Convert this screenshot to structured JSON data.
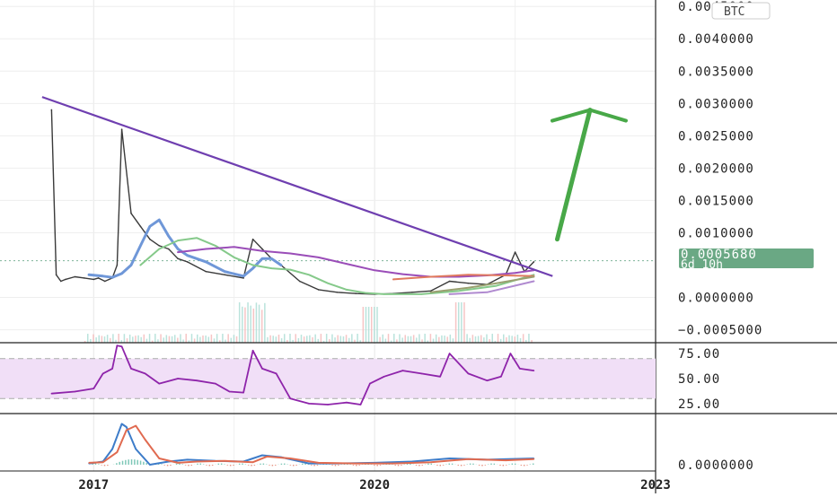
{
  "chart_data": [
    {
      "type": "line",
      "panel": "price",
      "currency_badge": "BTC",
      "ylim": [
        -0.0007,
        0.0046
      ],
      "y_ticks": [
        {
          "v": 0.0045,
          "label": "0.0045000"
        },
        {
          "v": 0.004,
          "label": "0.0040000"
        },
        {
          "v": 0.0035,
          "label": "0.0035000"
        },
        {
          "v": 0.003,
          "label": "0.0030000"
        },
        {
          "v": 0.0025,
          "label": "0.0025000"
        },
        {
          "v": 0.002,
          "label": "0.0020000"
        },
        {
          "v": 0.0015,
          "label": "0.0015000"
        },
        {
          "v": 0.001,
          "label": "0.0010000"
        },
        {
          "v": 0.0,
          "label": "0.0000000"
        },
        {
          "v": -0.0005,
          "label": "−0.0005000"
        }
      ],
      "last_price": {
        "value": 0.000568,
        "label": "0.0005680",
        "countdown": "6d 10h"
      },
      "series": [
        {
          "role": "price",
          "color": "#3a3a3a",
          "x": [
            2016.55,
            2016.6,
            2016.65,
            2016.7,
            2016.8,
            2016.9,
            2017.0,
            2017.05,
            2017.12,
            2017.2,
            2017.25,
            2017.3,
            2017.4,
            2017.5,
            2017.6,
            2017.7,
            2017.8,
            2017.9,
            2018.0,
            2018.2,
            2018.4,
            2018.6,
            2018.7,
            2018.8,
            2018.9,
            2019.0,
            2019.2,
            2019.4,
            2019.6,
            2019.8,
            2020.0,
            2020.2,
            2020.4,
            2020.6,
            2020.8,
            2021.0,
            2021.2,
            2021.4,
            2021.5,
            2021.6,
            2021.7
          ],
          "y": [
            0.0029,
            0.00035,
            0.00025,
            0.00028,
            0.00032,
            0.0003,
            0.00028,
            0.0003,
            0.00025,
            0.0003,
            0.0005,
            0.0026,
            0.0013,
            0.0011,
            0.0009,
            0.0008,
            0.00075,
            0.0006,
            0.00055,
            0.0004,
            0.00035,
            0.0003,
            0.0009,
            0.00075,
            0.0006,
            0.0005,
            0.00025,
            0.00012,
            8e-05,
            6e-05,
            5e-05,
            6e-05,
            8e-05,
            0.0001,
            0.00025,
            0.00022,
            0.0002,
            0.00035,
            0.0007,
            0.0004,
            0.00055
          ]
        },
        {
          "role": "ma-blue",
          "color": "#6f97d8",
          "x": [
            2016.95,
            2017.1,
            2017.2,
            2017.3,
            2017.4,
            2017.5,
            2017.6,
            2017.7,
            2017.8,
            2017.9,
            2018.0,
            2018.2,
            2018.4,
            2018.6,
            2018.7,
            2018.8,
            2018.9,
            2019.0
          ],
          "y": [
            0.00035,
            0.00033,
            0.00031,
            0.00037,
            0.0005,
            0.0008,
            0.0011,
            0.0012,
            0.00095,
            0.00075,
            0.00065,
            0.00055,
            0.0004,
            0.00033,
            0.00045,
            0.0006,
            0.0006,
            0.0005
          ]
        },
        {
          "role": "ma-green",
          "color": "#85c98a",
          "x": [
            2017.5,
            2017.7,
            2017.9,
            2018.1,
            2018.3,
            2018.5,
            2018.7,
            2018.9,
            2019.1,
            2019.3,
            2019.5,
            2019.7,
            2019.9,
            2020.1,
            2020.5,
            2020.9,
            2021.3,
            2021.7
          ],
          "y": [
            0.0005,
            0.00075,
            0.00088,
            0.00092,
            0.0008,
            0.00062,
            0.0005,
            0.00045,
            0.00043,
            0.00035,
            0.00022,
            0.00012,
            7e-05,
            5e-05,
            5e-05,
            0.0001,
            0.00018,
            0.00035
          ]
        },
        {
          "role": "ma-purple",
          "color": "#9a4db8",
          "x": [
            2017.9,
            2018.2,
            2018.5,
            2018.8,
            2019.1,
            2019.4,
            2019.7,
            2020.0,
            2020.3,
            2020.6,
            2020.9,
            2021.2,
            2021.5,
            2021.7
          ],
          "y": [
            0.0007,
            0.00075,
            0.00078,
            0.00072,
            0.00068,
            0.00062,
            0.00052,
            0.00042,
            0.00036,
            0.00032,
            0.00032,
            0.00034,
            0.00038,
            0.00042
          ]
        },
        {
          "role": "ma-red",
          "color": "#e07a5f",
          "x": [
            2020.2,
            2020.6,
            2021.0,
            2021.4,
            2021.7
          ],
          "y": [
            0.00028,
            0.00032,
            0.00035,
            0.00034,
            0.00033
          ]
        },
        {
          "role": "ma-olive",
          "color": "#9aa070",
          "x": [
            2020.6,
            2021.0,
            2021.3,
            2021.7
          ],
          "y": [
            8e-05,
            0.00015,
            0.00022,
            0.00032
          ]
        },
        {
          "role": "ma-lavender",
          "color": "#b08ad0",
          "x": [
            2020.8,
            2021.2,
            2021.7
          ],
          "y": [
            5e-05,
            8e-05,
            0.00025
          ]
        }
      ],
      "annotations": {
        "trendline": {
          "color": "#6f3fb0",
          "x": [
            2016.45,
            2021.9
          ],
          "y": [
            0.0031,
            0.00033
          ]
        },
        "arrow": {
          "color": "#48a848",
          "from": [
            2021.95,
            0.0009
          ],
          "to": [
            2022.3,
            0.0029
          ]
        }
      }
    },
    {
      "type": "line",
      "panel": "rsi",
      "ylim": [
        15,
        85
      ],
      "y_ticks": [
        {
          "v": 75,
          "label": "75.00"
        },
        {
          "v": 50,
          "label": "50.00"
        },
        {
          "v": 25,
          "label": "25.00"
        }
      ],
      "band": [
        30,
        70
      ],
      "series": [
        {
          "role": "rsi",
          "color": "#8e24aa",
          "x": [
            2016.55,
            2016.8,
            2017.0,
            2017.1,
            2017.2,
            2017.25,
            2017.3,
            2017.4,
            2017.55,
            2017.7,
            2017.9,
            2018.1,
            2018.3,
            2018.45,
            2018.6,
            2018.7,
            2018.8,
            2018.95,
            2019.1,
            2019.3,
            2019.5,
            2019.7,
            2019.85,
            2019.95,
            2020.1,
            2020.3,
            2020.5,
            2020.7,
            2020.8,
            2021.0,
            2021.2,
            2021.35,
            2021.45,
            2021.55,
            2021.7
          ],
          "y": [
            35,
            37,
            40,
            55,
            60,
            83,
            82,
            60,
            55,
            45,
            50,
            48,
            45,
            37,
            36,
            78,
            60,
            55,
            30,
            25,
            24,
            26,
            24,
            45,
            52,
            58,
            55,
            52,
            75,
            55,
            48,
            52,
            75,
            60,
            58
          ]
        }
      ]
    },
    {
      "type": "line",
      "panel": "macd",
      "ylim": [
        -1,
        8
      ],
      "y_ticks": [
        {
          "v": 0,
          "label": "0.0000000"
        }
      ],
      "series": [
        {
          "role": "macd",
          "color": "#3d7cc9",
          "x": [
            2016.95,
            2017.1,
            2017.2,
            2017.3,
            2017.35,
            2017.45,
            2017.6,
            2017.8,
            2018.0,
            2018.3,
            2018.6,
            2018.8,
            2019.0,
            2019.3,
            2019.6,
            2020.0,
            2020.4,
            2020.8,
            2021.2,
            2021.7
          ],
          "y": [
            0.2,
            0.5,
            2.5,
            6.5,
            6.0,
            2.5,
            0.0,
            0.5,
            0.8,
            0.6,
            0.5,
            1.5,
            1.2,
            0.2,
            0.2,
            0.3,
            0.5,
            1.0,
            0.8,
            1.0
          ]
        },
        {
          "role": "signal",
          "color": "#e06a50",
          "x": [
            2016.95,
            2017.1,
            2017.25,
            2017.35,
            2017.45,
            2017.55,
            2017.7,
            2017.9,
            2018.1,
            2018.4,
            2018.7,
            2018.85,
            2019.1,
            2019.4,
            2019.8,
            2020.2,
            2020.6,
            2021.0,
            2021.4,
            2021.7
          ],
          "y": [
            0.3,
            0.4,
            2.0,
            5.5,
            6.2,
            4.0,
            1.0,
            0.3,
            0.5,
            0.6,
            0.4,
            1.3,
            1.0,
            0.3,
            0.2,
            0.2,
            0.4,
            0.9,
            0.7,
            0.9
          ]
        }
      ]
    }
  ],
  "x_axis": {
    "xlim": [
      2016.0,
      2023.0
    ],
    "ticks": [
      {
        "v": 2017,
        "label": "2017"
      },
      {
        "v": 2020,
        "label": "2020"
      },
      {
        "v": 2023,
        "label": "2023"
      }
    ]
  }
}
